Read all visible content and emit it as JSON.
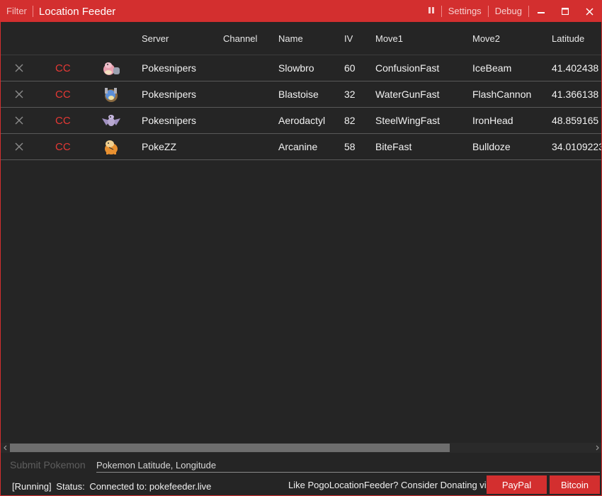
{
  "titlebar": {
    "filter_label": "Filter",
    "title": "Location Feeder",
    "pause_icon": "pause-icon",
    "settings_label": "Settings",
    "debug_label": "Debug",
    "minimize_icon": "minimize-icon",
    "maximize_icon": "maximize-icon",
    "close_icon": "close-icon"
  },
  "colors": {
    "accent": "#d32f2f",
    "background": "#252525",
    "cc_text": "#e53935"
  },
  "table": {
    "columns": [
      "Server",
      "Channel",
      "Name",
      "IV",
      "Move1",
      "Move2",
      "Latitude"
    ],
    "rows": [
      {
        "remove_icon": "x-icon",
        "cc": "CC",
        "sprite": "slowbro-sprite-icon",
        "server": "Pokesnipers",
        "channel": "",
        "name": "Slowbro",
        "iv": "60",
        "move1": "ConfusionFast",
        "move2": "IceBeam",
        "latitude": "41.402438"
      },
      {
        "remove_icon": "x-icon",
        "cc": "CC",
        "sprite": "blastoise-sprite-icon",
        "server": "Pokesnipers",
        "channel": "",
        "name": "Blastoise",
        "iv": "32",
        "move1": "WaterGunFast",
        "move2": "FlashCannon",
        "latitude": "41.366138"
      },
      {
        "remove_icon": "x-icon",
        "cc": "CC",
        "sprite": "aerodactyl-sprite-icon",
        "server": "Pokesnipers",
        "channel": "",
        "name": "Aerodactyl",
        "iv": "82",
        "move1": "SteelWingFast",
        "move2": "IronHead",
        "latitude": "48.859165"
      },
      {
        "remove_icon": "x-icon",
        "cc": "CC",
        "sprite": "arcanine-sprite-icon",
        "server": "PokeZZ",
        "channel": "",
        "name": "Arcanine",
        "iv": "58",
        "move1": "BiteFast",
        "move2": "Bulldoze",
        "latitude": "34.0109223"
      }
    ]
  },
  "submit": {
    "label": "Submit Pokemon",
    "placeholder": "Pokemon Latitude, Longitude"
  },
  "status": {
    "state": "[Running]",
    "label": "Status:",
    "text": "Connected to: pokefeeder.live"
  },
  "donate": {
    "text": "Like PogoLocationFeeder? Consider Donating via",
    "paypal_label": "PayPal",
    "bitcoin_label": "Bitcoin"
  }
}
